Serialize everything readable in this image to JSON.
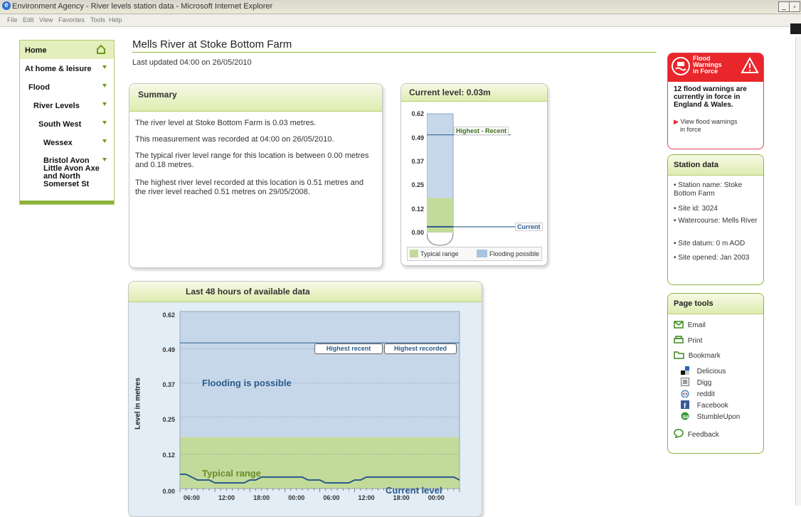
{
  "window": {
    "title": "Environment Agency - River levels station data - Microsoft Internet Explorer",
    "menu": [
      "File",
      "Edit",
      "View",
      "Favorites",
      "Tools",
      "Help"
    ]
  },
  "nav": {
    "items": [
      {
        "label": "Home"
      },
      {
        "label": "At home & leisure"
      },
      {
        "label": "Flood"
      },
      {
        "label": "River Levels"
      },
      {
        "label": "South West"
      },
      {
        "label": "Wessex"
      },
      {
        "label": "Bristol Avon Little Avon Axe and North Somerset St"
      }
    ]
  },
  "page": {
    "title": "Mells River at Stoke Bottom Farm",
    "updated": "Last updated 04:00 on 26/05/2010"
  },
  "summary": {
    "heading": "Summary",
    "p1": "The river level at Stoke Bottom Farm is 0.03 metres.",
    "p2": "This measurement was recorded at 04:00 on 26/05/2010.",
    "p3": "The typical river level range for this location is between 0.00 metres and 0.18 metres.",
    "p4": "The highest river level recorded at this location is 0.51 metres and the river level reached 0.51 metres on 29/05/2008."
  },
  "current_level": {
    "heading": "Current level: 0.03m",
    "highest_label": "Highest - Recent",
    "current_label": "Current",
    "legend_typical": "Typical range",
    "legend_flooding": "Flooding possible"
  },
  "history": {
    "heading": "Last 48 hours of available data",
    "ylabel": "Level in metres",
    "flooding_label": "Flooding is possible",
    "typical_label": "Typical range",
    "current_label": "Current level",
    "highest_recent_label": "Highest recent",
    "highest_recorded_label": "Highest recorded"
  },
  "colors": {
    "typical": "#c3db9a",
    "flooding": "#c7d7ea",
    "line": "#2a5a8a",
    "accent": "#8bb33a",
    "warning": "#e8262b"
  },
  "chart_data": [
    {
      "type": "bar",
      "title": "Current level: 0.03m",
      "yticks": [
        "0.62",
        "0.49",
        "0.37",
        "0.25",
        "0.12",
        "0.00"
      ],
      "ylim": [
        0,
        0.62
      ],
      "current": 0.03,
      "highest_recent": 0.51,
      "typical_range": [
        0.0,
        0.18
      ],
      "legend": [
        "Typical range",
        "Flooding possible"
      ],
      "legend_position": "bottom"
    },
    {
      "type": "line",
      "title": "Last 48 hours of available data",
      "ylabel": "Level in metres",
      "yticks": [
        "0.62",
        "0.49",
        "0.37",
        "0.25",
        "0.12",
        "0.00"
      ],
      "xticks": [
        "06:00",
        "12:00",
        "18:00",
        "00:00",
        "06:00",
        "12:00",
        "18:00",
        "00:00"
      ],
      "ylim": [
        0,
        0.62
      ],
      "xlim": [
        0,
        48
      ],
      "highest_recent": 0.51,
      "highest_recorded": 0.51,
      "typical_range": [
        0.0,
        0.18
      ],
      "series": [
        {
          "name": "Current level",
          "x": [
            0,
            1,
            2,
            3,
            5,
            6,
            7,
            9,
            10,
            11,
            12,
            13,
            14,
            15,
            17,
            18,
            19,
            20,
            21,
            22,
            23,
            24,
            25,
            26,
            27,
            28,
            29,
            30,
            31,
            32,
            33,
            34,
            35,
            36,
            37,
            38,
            39,
            40,
            41,
            42,
            43,
            44,
            45,
            46,
            47,
            48
          ],
          "y": [
            0.05,
            0.05,
            0.04,
            0.03,
            0.03,
            0.02,
            0.02,
            0.02,
            0.02,
            0.02,
            0.03,
            0.03,
            0.04,
            0.04,
            0.04,
            0.04,
            0.04,
            0.04,
            0.04,
            0.03,
            0.03,
            0.03,
            0.02,
            0.02,
            0.02,
            0.02,
            0.02,
            0.03,
            0.03,
            0.04,
            0.04,
            0.04,
            0.04,
            0.04,
            0.04,
            0.04,
            0.04,
            0.04,
            0.04,
            0.04,
            0.04,
            0.04,
            0.04,
            0.04,
            0.04,
            0.03
          ]
        }
      ],
      "grid": true
    }
  ],
  "warnings": {
    "title1": "Flood",
    "title2": "Warnings",
    "title3": "in Force",
    "text": "12 flood warnings are currently in force in England & Wales.",
    "link1": "View flood warnings",
    "link2": "in force"
  },
  "station": {
    "heading": "Station data",
    "items": [
      "Station name: Stoke Bottom Farm",
      "Site id: 3024",
      "Watercourse: Mells River",
      "Site datum: 0 m AOD",
      "Site opened: Jan 2003"
    ]
  },
  "tools": {
    "heading": "Page tools",
    "email": "Email",
    "print": "Print",
    "bookmark": "Bookmark",
    "social": [
      "Delicious",
      "Digg",
      "reddit",
      "Facebook",
      "StumbleUpon"
    ],
    "feedback": "Feedback"
  }
}
